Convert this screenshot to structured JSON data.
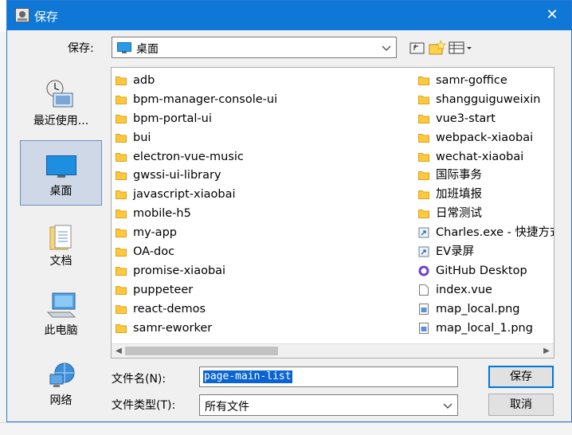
{
  "window": {
    "title": "保存",
    "close_glyph": "✕"
  },
  "save_in": {
    "label": "保存:",
    "value": "桌面"
  },
  "toolbar": {
    "icons": [
      "up-folder-icon",
      "new-folder-icon",
      "view-menu-icon"
    ]
  },
  "places": [
    {
      "label": "最近使用...",
      "icon": "recent-icon",
      "selected": false
    },
    {
      "label": "桌面",
      "icon": "desktop-icon",
      "selected": true
    },
    {
      "label": "文档",
      "icon": "documents-icon",
      "selected": false
    },
    {
      "label": "此电脑",
      "icon": "computer-icon",
      "selected": false
    },
    {
      "label": "网络",
      "icon": "network-icon",
      "selected": false
    }
  ],
  "files": {
    "column1": [
      "adb",
      "bpm-manager-console-ui",
      "bpm-portal-ui",
      "bui",
      "electron-vue-music",
      "gwssi-ui-library",
      "javascript-xiaobai",
      "mobile-h5",
      "my-app",
      "OA-doc",
      "promise-xiaobai",
      "puppeteer",
      "react-demos",
      "samr-eworker"
    ],
    "column2": [
      {
        "name": "samr-goffice",
        "type": "folder"
      },
      {
        "name": "shangguiguweixin",
        "type": "folder"
      },
      {
        "name": "vue3-start",
        "type": "folder"
      },
      {
        "name": "webpack-xiaobai",
        "type": "folder"
      },
      {
        "name": "wechat-xiaobai",
        "type": "folder"
      },
      {
        "name": "国际事务",
        "type": "folder"
      },
      {
        "name": "加班填报",
        "type": "folder"
      },
      {
        "name": "日常测试",
        "type": "folder"
      },
      {
        "name": "Charles.exe - 快捷方式",
        "type": "shortcut"
      },
      {
        "name": "EV录屏",
        "type": "shortcut"
      },
      {
        "name": "GitHub Desktop",
        "type": "github"
      },
      {
        "name": "index.vue",
        "type": "file"
      },
      {
        "name": "map_local.png",
        "type": "image"
      },
      {
        "name": "map_local_1.png",
        "type": "image"
      }
    ]
  },
  "filename": {
    "label": "文件名(N):",
    "value": "page-main-list"
  },
  "filetype": {
    "label": "文件类型(T):",
    "value": "所有文件"
  },
  "buttons": {
    "save": "保存",
    "cancel": "取消"
  },
  "colors": {
    "titlebar": "#0f78d7",
    "selection": "#0a64d2",
    "folder": "#ffc83d"
  }
}
